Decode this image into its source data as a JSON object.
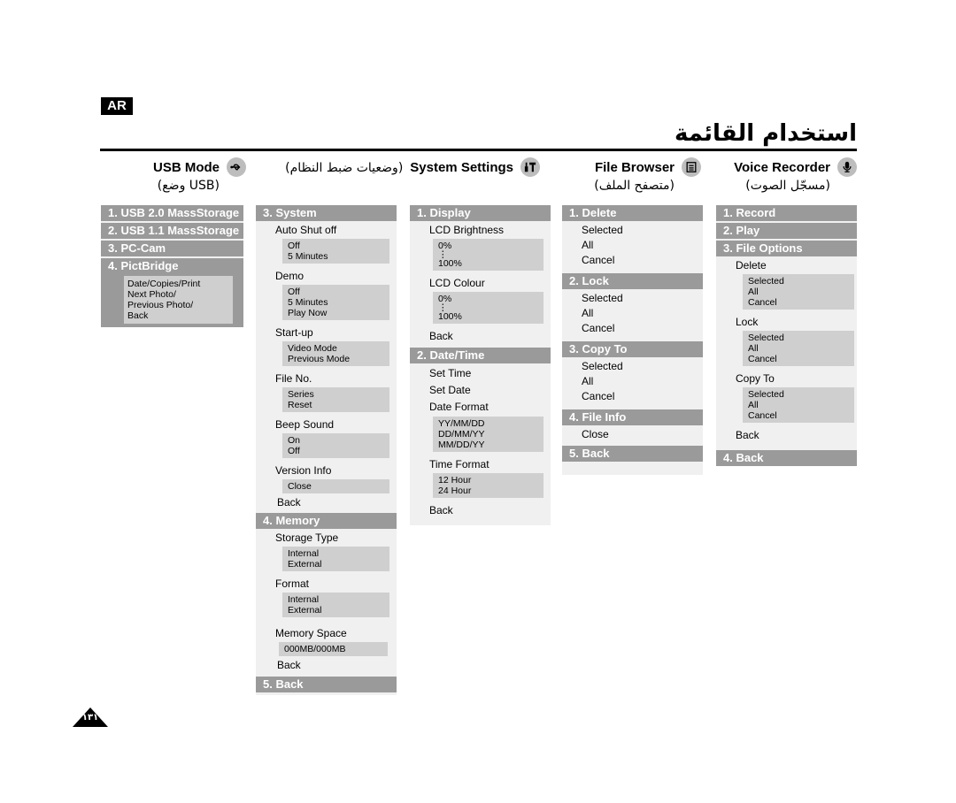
{
  "badge": "AR",
  "title": "استخدام القائمة",
  "page_number": "١٣١",
  "columns": [
    {
      "en": "USB Mode",
      "ar": "(وضع USB)",
      "icon": "usb-icon"
    },
    {
      "en": "System Settings",
      "ar": "(وضعيات ضبط النظام)",
      "icon": "tools-icon"
    },
    {
      "en": "File Browser",
      "ar": "(متصفح الملف)",
      "icon": "document-icon"
    },
    {
      "en": "Voice Recorder",
      "ar": "(مسجّل الصوت)",
      "icon": "microphone-icon"
    }
  ],
  "usb": {
    "headers": [
      "1. USB 2.0 MassStorage",
      "2. USB 1.1 MassStorage",
      "3. PC-Cam",
      "4. PictBridge"
    ],
    "pictbridge_options": [
      "Date/Copies/Print",
      "Next Photo/",
      "Previous Photo/",
      "Back"
    ]
  },
  "system": {
    "header": "3. System",
    "auto_shut_off": {
      "label": "Auto Shut off",
      "options": [
        "Off",
        "5 Minutes"
      ]
    },
    "demo": {
      "label": "Demo",
      "options": [
        "Off",
        "5 Minutes",
        "Play Now"
      ]
    },
    "startup": {
      "label": "Start-up",
      "options": [
        "Video Mode",
        "Previous Mode"
      ]
    },
    "file_no": {
      "label": "File No.",
      "options": [
        "Series",
        "Reset"
      ]
    },
    "beep": {
      "label": "Beep Sound",
      "options": [
        "On",
        "Off"
      ]
    },
    "version": {
      "label": "Version Info",
      "options": [
        "Close"
      ]
    },
    "back": "Back",
    "memory_header": "4. Memory",
    "storage": {
      "label": "Storage Type",
      "options": [
        "Internal",
        "External"
      ]
    },
    "format": {
      "label": "Format",
      "options": [
        "Internal",
        "External"
      ]
    },
    "space": {
      "label": "Memory Space",
      "value": "000MB/000MB"
    },
    "memory_back": "Back",
    "back_header": "5. Back"
  },
  "display": {
    "header": "1. Display",
    "brightness": {
      "label": "LCD Brightness",
      "min": "0%",
      "dots": "⋮",
      "max": "100%"
    },
    "colour": {
      "label": "LCD Colour",
      "min": "0%",
      "dots": "⋮",
      "max": "100%"
    },
    "back": "Back",
    "datetime_header": "2. Date/Time",
    "set_time": "Set Time",
    "set_date": "Set Date",
    "date_format": {
      "label": "Date Format",
      "options": [
        "YY/MM/DD",
        "DD/MM/YY",
        "MM/DD/YY"
      ]
    },
    "time_format": {
      "label": "Time Format",
      "options": [
        "12 Hour",
        "24 Hour"
      ]
    },
    "dt_back": "Back"
  },
  "file_browser": {
    "delete": {
      "header": "1. Delete",
      "options": [
        "Selected",
        "All",
        "Cancel"
      ]
    },
    "lock": {
      "header": "2. Lock",
      "options": [
        "Selected",
        "All",
        "Cancel"
      ]
    },
    "copy": {
      "header": "3. Copy To",
      "options": [
        "Selected",
        "All",
        "Cancel"
      ]
    },
    "info": {
      "header": "4. File Info",
      "options": [
        "Close"
      ]
    },
    "back_header": "5. Back"
  },
  "voice": {
    "headers": [
      "1. Record",
      "2. Play",
      "3. File Options"
    ],
    "delete": {
      "label": "Delete",
      "options": [
        "Selected",
        "All",
        "Cancel"
      ]
    },
    "lock": {
      "label": "Lock",
      "options": [
        "Selected",
        "All",
        "Cancel"
      ]
    },
    "copy": {
      "label": "Copy To",
      "options": [
        "Selected",
        "All",
        "Cancel"
      ]
    },
    "back": "Back",
    "back_header": "4. Back"
  }
}
